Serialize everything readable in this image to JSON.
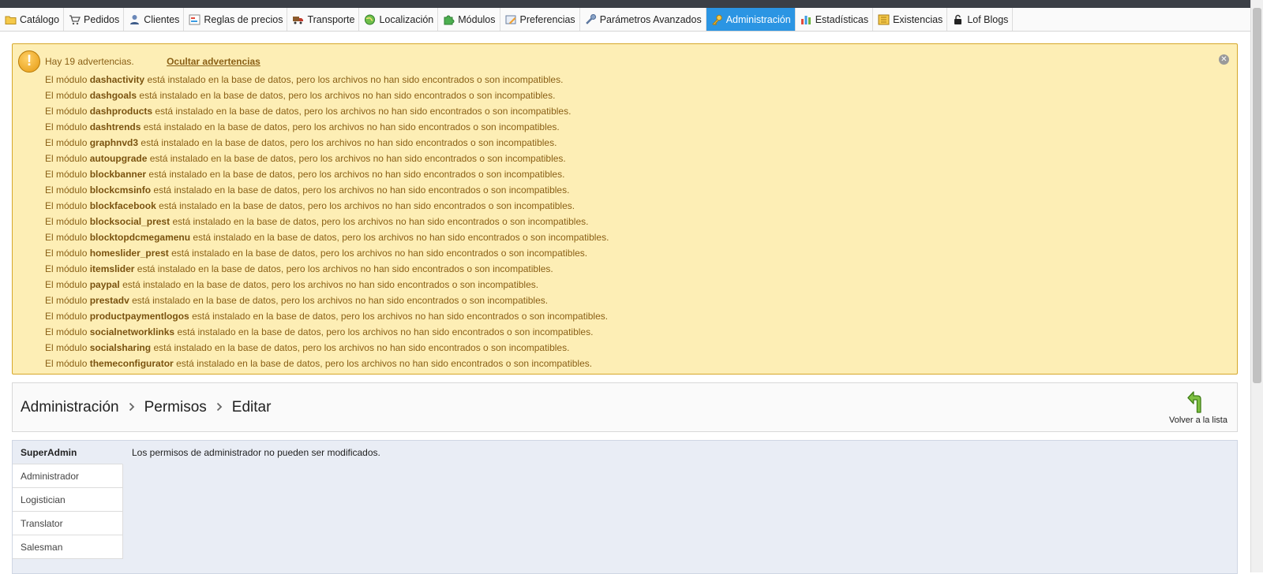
{
  "menu": [
    {
      "label": "Catálogo",
      "icon": "folder-icon",
      "active": false
    },
    {
      "label": "Pedidos",
      "icon": "cart-icon",
      "active": false
    },
    {
      "label": "Clientes",
      "icon": "user-icon",
      "active": false
    },
    {
      "label": "Reglas de precios",
      "icon": "price-rules-icon",
      "active": false
    },
    {
      "label": "Transporte",
      "icon": "truck-icon",
      "active": false
    },
    {
      "label": "Localización",
      "icon": "globe-icon",
      "active": false
    },
    {
      "label": "Módulos",
      "icon": "puzzle-icon",
      "active": false
    },
    {
      "label": "Preferencias",
      "icon": "preferences-icon",
      "active": false
    },
    {
      "label": "Parámetros Avanzados",
      "icon": "wrench-icon",
      "active": false
    },
    {
      "label": "Administración",
      "icon": "key-icon",
      "active": true
    },
    {
      "label": "Estadísticas",
      "icon": "bar-chart-icon",
      "active": false
    },
    {
      "label": "Existencias",
      "icon": "stock-icon",
      "active": false
    },
    {
      "label": "Lof Blogs",
      "icon": "lock-icon",
      "active": false
    }
  ],
  "warnings": {
    "summary": "Hay 19 advertencias.",
    "hide_label": "Ocultar advertencias",
    "prefix": "El módulo",
    "suffix": "está instalado en la base de datos, pero los archivos no han sido encontrados o son incompatibles.",
    "modules": [
      "dashactivity",
      "dashgoals",
      "dashproducts",
      "dashtrends",
      "graphnvd3",
      "autoupgrade",
      "blockbanner",
      "blockcmsinfo",
      "blockfacebook",
      "blocksocial_prest",
      "blocktopdcmegamenu",
      "homeslider_prest",
      "itemslider",
      "paypal",
      "prestadv",
      "productpaymentlogos",
      "socialnetworklinks",
      "socialsharing",
      "themeconfigurator"
    ],
    "colors": {
      "background": "#fdeeb5",
      "border": "#d6a72a",
      "text": "#8a6016"
    }
  },
  "breadcrumb": [
    "Administración",
    "Permisos",
    "Editar"
  ],
  "back_label": "Volver a la lista",
  "profiles": [
    {
      "label": "SuperAdmin",
      "active": true
    },
    {
      "label": "Administrador",
      "active": false
    },
    {
      "label": "Logistician",
      "active": false
    },
    {
      "label": "Translator",
      "active": false
    },
    {
      "label": "Salesman",
      "active": false
    }
  ],
  "permissions_message": "Los permisos de administrador no pueden ser modificados.",
  "accent_color": "#2b95e3"
}
